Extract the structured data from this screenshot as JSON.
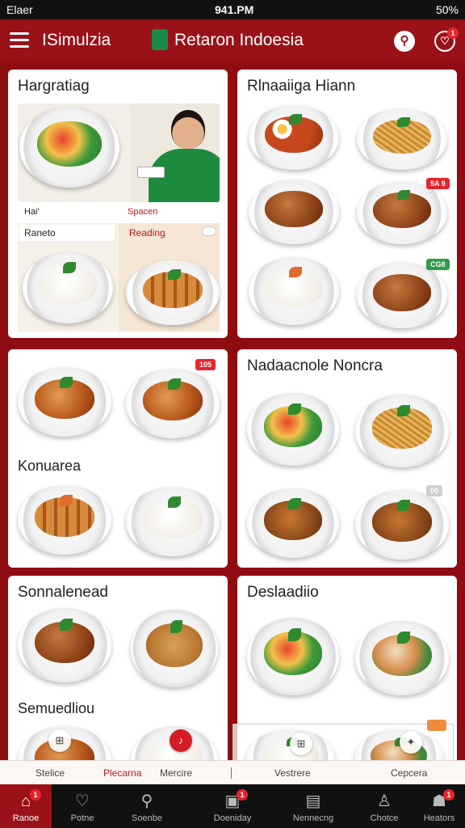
{
  "status_bar": {
    "left": "Elaer",
    "time": "941.PM",
    "right": "50%"
  },
  "header": {
    "app_name": "ISimulzia",
    "brand_title": "Retaron Indoesia",
    "notif_badge": "1"
  },
  "cards": [
    {
      "title": "Hargratiag",
      "promo": {
        "label_left": "Hai'",
        "label_right": "Spacen",
        "input_left": "Raneto",
        "input_right": "Reading"
      }
    },
    {
      "title": "Rlnaaiiga Hiann",
      "tags": [
        "5A 9",
        "CG8"
      ]
    },
    {
      "title": "Konuarea",
      "tags": [
        "105"
      ]
    },
    {
      "title": "Nadaacnole Noncra",
      "tags": [
        "00"
      ]
    },
    {
      "title": "Sonnalenead",
      "subtitle": "Semuedliou"
    },
    {
      "title": "Deslaadiio"
    }
  ],
  "sub_tabs": [
    {
      "label": "Stelice",
      "active": false
    },
    {
      "label": "Plecarna",
      "active": true
    },
    {
      "label": "Mercire",
      "active": false
    },
    {
      "label": "Vestrere",
      "active": false
    },
    {
      "label": "Cepcera",
      "active": false
    }
  ],
  "bottom_nav": [
    {
      "label": "Ranoe",
      "icon": "home-icon",
      "badge": "1",
      "active": true
    },
    {
      "label": "Potne",
      "icon": "heart-icon",
      "badge": "",
      "active": false
    },
    {
      "label": "Soenbe",
      "icon": "search-icon",
      "badge": "",
      "active": false
    },
    {
      "label": "Doeniday",
      "icon": "order-icon",
      "badge": "1",
      "active": false
    },
    {
      "label": "Nennecng",
      "icon": "document-icon",
      "badge": "",
      "active": false
    },
    {
      "label": "Chotce",
      "icon": "profile-icon",
      "badge": "",
      "active": false
    },
    {
      "label": "Heators",
      "icon": "account-icon",
      "badge": "1",
      "active": false
    }
  ],
  "colors": {
    "brand": "#9a1118",
    "accent": "#e8242c",
    "green": "#1c8a4a"
  }
}
